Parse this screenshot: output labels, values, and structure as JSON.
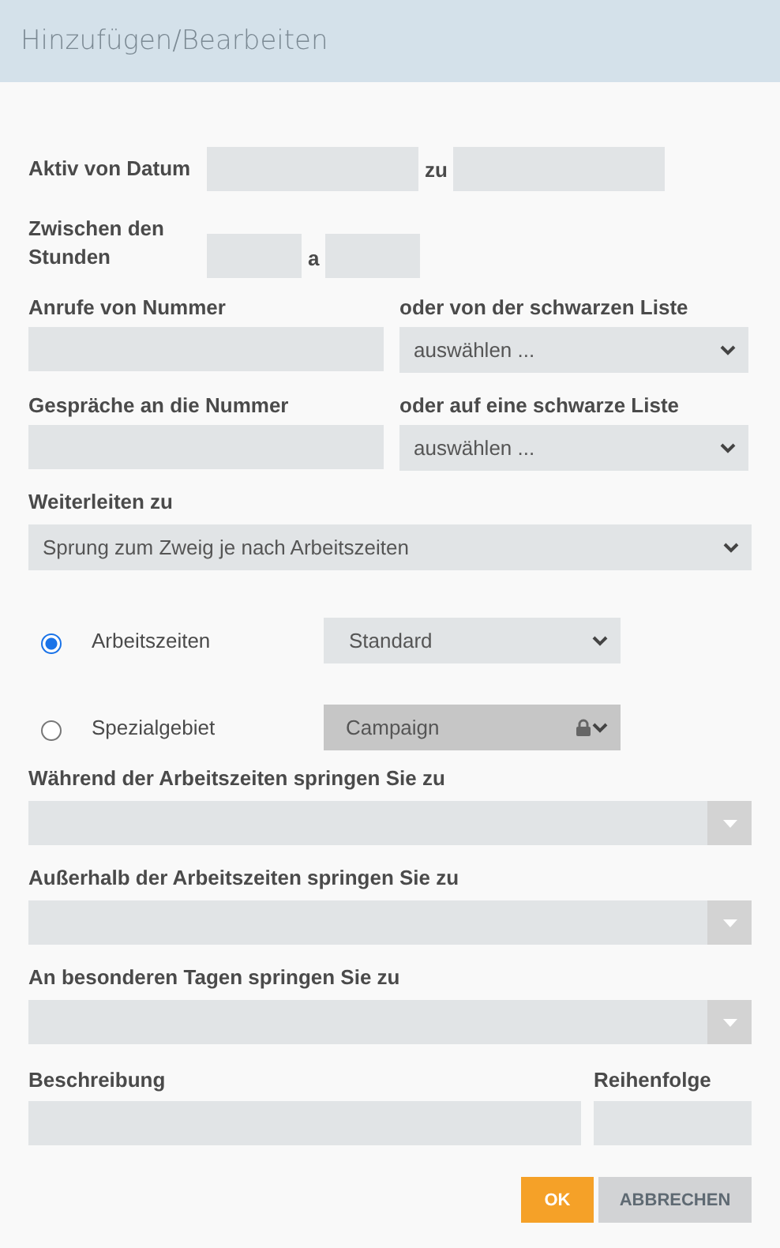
{
  "window": {
    "title": "Hinzufügen/Bearbeiten"
  },
  "date_range": {
    "label": "Aktiv von Datum",
    "separator": "zu"
  },
  "hour_range": {
    "label": "Zwischen den Stunden",
    "separator": "a"
  },
  "number_filters": [
    {
      "number_label": "Anrufe von Nummer",
      "list_label": "oder von der schwarzen Liste",
      "list_value": "auswählen ..."
    },
    {
      "number_label": "Gespräche an die Nummer",
      "list_label": "oder auf eine schwarze Liste",
      "list_value": "auswählen ..."
    }
  ],
  "forward": {
    "label": "Weiterleiten zu",
    "value": "Sprung zum Zweig je nach Arbeitszeiten"
  },
  "schedule_options": [
    {
      "label": "Arbeitszeiten",
      "selected": true,
      "value": "Standard",
      "disabled": false
    },
    {
      "label": "Spezialgebiet",
      "selected": false,
      "value": "Campaign",
      "disabled": true
    }
  ],
  "jumps": [
    {
      "label": "Während der Arbeitszeiten springen Sie zu"
    },
    {
      "label": "Außerhalb der Arbeitszeiten springen Sie zu"
    },
    {
      "label": "An besonderen Tagen springen Sie zu"
    }
  ],
  "description": {
    "label": "Beschreibung"
  },
  "order": {
    "label": "Reihenfolge"
  },
  "buttons": [
    {
      "label": "OK",
      "kind": "primary"
    },
    {
      "label": "ABBRECHEN",
      "kind": "secondary"
    }
  ]
}
